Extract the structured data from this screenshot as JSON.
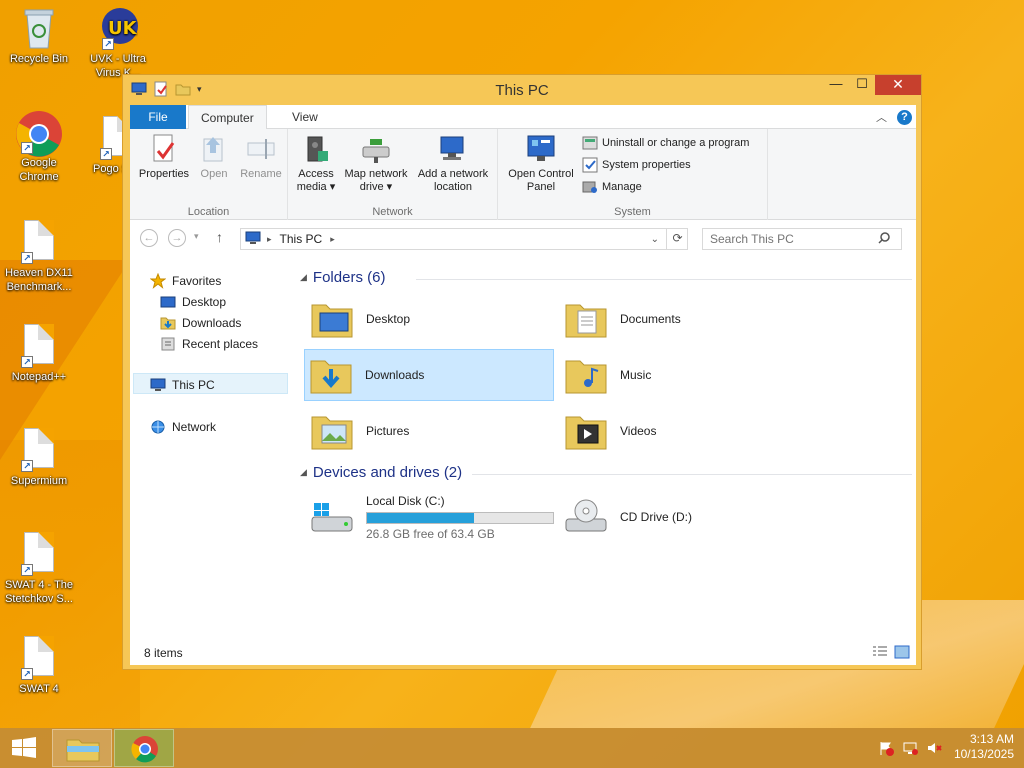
{
  "desktop": {
    "icons": [
      {
        "label": "Recycle Bin",
        "icon": "recycle-bin-icon"
      },
      {
        "label": "UVK - Ultra Virus K...",
        "icon": "uvk-icon"
      },
      {
        "label": "Google Chrome",
        "icon": "chrome-icon"
      },
      {
        "label": "Pogo Sy...",
        "icon": "document-icon"
      },
      {
        "label": "Heaven DX11 Benchmark...",
        "icon": "document-icon"
      },
      {
        "label": "Notepad++",
        "icon": "document-icon"
      },
      {
        "label": "Supermium",
        "icon": "document-icon"
      },
      {
        "label": "SWAT 4 - The Stetchkov S...",
        "icon": "document-icon"
      },
      {
        "label": "SWAT 4",
        "icon": "document-icon"
      }
    ]
  },
  "window": {
    "title": "This PC",
    "controls": {
      "minimize": "—",
      "maximize": "☐",
      "close": "✕"
    }
  },
  "ribbon": {
    "tabs": {
      "file": "File",
      "computer": "Computer",
      "view": "View"
    },
    "location": {
      "label": "Location",
      "properties": "Properties",
      "open": "Open",
      "rename": "Rename"
    },
    "network": {
      "label": "Network",
      "access_media": "Access media ▾",
      "map_network_drive": "Map network drive ▾",
      "add_network_location": "Add a network location"
    },
    "system": {
      "label": "System",
      "open_control_panel": "Open Control Panel",
      "uninstall": "Uninstall or change a program",
      "system_properties": "System properties",
      "manage": "Manage"
    }
  },
  "address": {
    "path": "This PC",
    "search_placeholder": "Search This PC"
  },
  "nav": {
    "favorites": "Favorites",
    "desktop": "Desktop",
    "downloads": "Downloads",
    "recent_places": "Recent places",
    "this_pc": "This PC",
    "network": "Network"
  },
  "content": {
    "folders_header": "Folders (6)",
    "folders": [
      "Desktop",
      "Documents",
      "Downloads",
      "Music",
      "Pictures",
      "Videos"
    ],
    "devices_header": "Devices and drives (2)",
    "local_disk": {
      "name": "Local Disk (C:)",
      "free_text": "26.8 GB free of 63.4 GB",
      "used_fraction": 0.577
    },
    "cd_drive": {
      "name": "CD Drive (D:)"
    }
  },
  "status": {
    "items": "8 items"
  },
  "taskbar": {
    "time": "3:13 AM",
    "date": "10/13/2025"
  },
  "colors": {
    "accent": "#1979ca",
    "selection": "#cce8ff",
    "wallpaper": "#f5a300"
  }
}
